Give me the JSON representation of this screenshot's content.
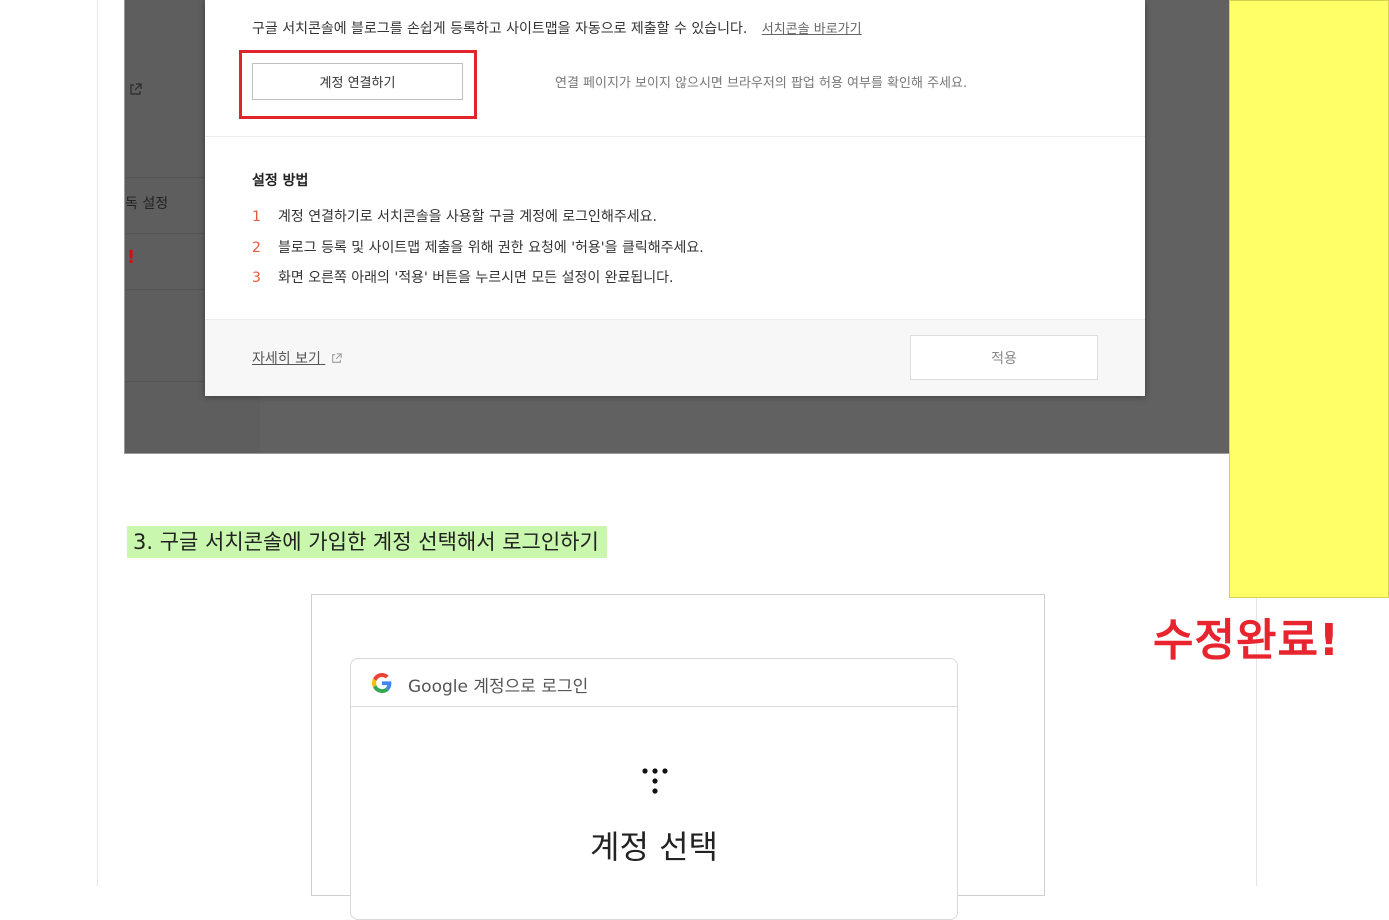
{
  "modal": {
    "description": "구글 서치콘솔에 블로그를 손쉽게 등록하고 사이트맵을 자동으로 제출할 수 있습니다.",
    "console_link": "서치콘솔 바로가기",
    "connect_button": "계정 연결하기",
    "popup_note": "연결 페이지가 보이지 않으시면 브라우저의 팝업 허용 여부를 확인해 주세요.",
    "steps_title": "설정 방법",
    "steps": [
      {
        "num": "1",
        "text": "계정 연결하기로 서치콘솔을 사용할 구글 계정에 로그인해주세요."
      },
      {
        "num": "2",
        "text": "블로그 등록 및 사이트맵 제출을 위해 권한 요청에 '허용'을 클릭해주세요."
      },
      {
        "num": "3",
        "text": "화면 오른쪽 아래의 '적용' 버튼을 누르시면 모든 설정이 완료됩니다."
      }
    ],
    "more_link": "자세히 보기",
    "apply_button": "적용"
  },
  "background_sidebar": {
    "partial_label": "독 설정",
    "partial_mark": "!"
  },
  "note_label": "수정완료!",
  "caption": "3. 구글 서치콘솔에 가입한 계정 선택해서 로그인하기",
  "google_login": {
    "header_title": "Google 계정으로 로그인",
    "heading": "계정 선택"
  },
  "colors": {
    "highlight_border": "#e0242d",
    "note_yellow": "#ffff66",
    "note_label": "#e8242e",
    "caption_highlight": "#c8f7ad",
    "step_number": "#e85a3c"
  },
  "icons": [
    "external-link-icon",
    "google-g-icon",
    "app-dots-icon"
  ]
}
